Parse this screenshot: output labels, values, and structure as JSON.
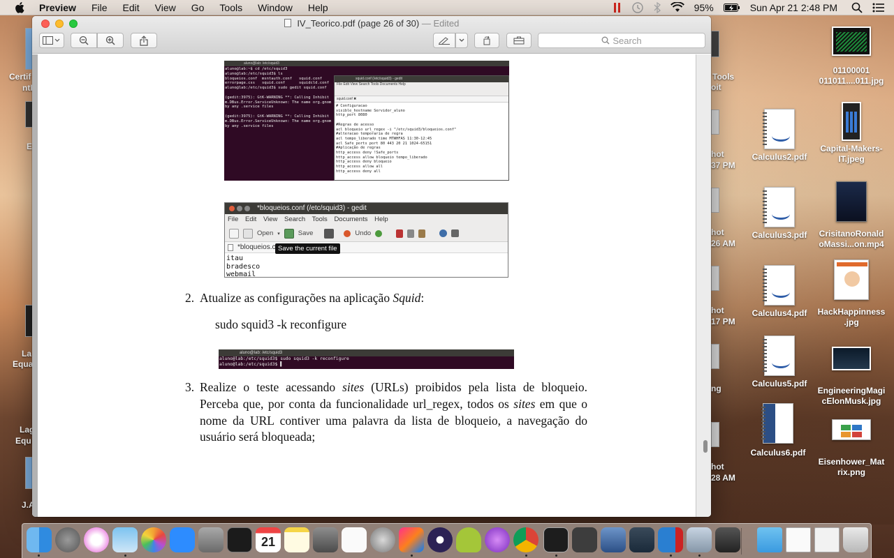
{
  "menubar": {
    "app_name": "Preview",
    "items": [
      "File",
      "Edit",
      "View",
      "Go",
      "Tools",
      "Window",
      "Help"
    ],
    "battery": "95%",
    "datetime": "Sun Apr 21  2:48 PM"
  },
  "window": {
    "title": "IV_Teorico.pdf (page 26 of 30)",
    "edited": "— Edited",
    "search_placeholder": "Search"
  },
  "screenshot1": {
    "terminal_title": "aluno@lab: /etc/squid3",
    "terminal_lines": "aluno@lab:~$ cd /etc/squid3\naluno@lab:/etc/squid3$ ls\nbloqueios.conf  msntauth.conf   squid.conf\nerrorpage.css   squid.conf      squidcld.conf\naluno@lab:/etc/squid3$ sudo gedit squid.conf\n\n(gedit:3975): GtK-WARNING **: Calling Inhibit\nm.DBus.Error.ServiceUnknown: The name org.gnom\nby any .service files\n\n(gedit:3975): GtK-WARNING **: Calling Inhibit\nm.DBus.Error.ServiceUnknown: The name org.gnom\nby any .service files",
    "gedit_title": "squid.conf (/etc/squid3) - gedit",
    "gedit_menu": "File  Edit  View  Search  Tools  Documents  Help",
    "gedit_tab": "squid.conf ✖",
    "gedit_body": "# Configuracao\nvisible_hostname Servidor_aluno\nhttp_port 8080\n\n#Regras de acesso\nacl bloqueio url_regex -i \"/etc/squid3/bloqueios.conf\"\n#alteracao temporaria de regra\nacl tempo_liberado time MTWHFAS 11:30-12:45\nacl Safe_ports port 80 443 20 21 1024-65151\n#Aplicação de regras\nhttp_access deny !Safe_ports\nhttp_access allow bloqueio tempo_liberado\nhttp_access deny bloqueio\nhttp_access allow all\nhttp_access deny all"
  },
  "screenshot2": {
    "title": "*bloqueios.conf (/etc/squid3) - gedit",
    "menu": [
      "File",
      "Edit",
      "View",
      "Search",
      "Tools",
      "Documents",
      "Help"
    ],
    "open_label": "Open",
    "save_label": "Save",
    "undo_label": "Undo",
    "tab_label": "*bloqueios.c",
    "tooltip": "Save the current file",
    "body": "itau\nbradesco\nwebmail"
  },
  "item2": {
    "number": "2.",
    "text_plain": "Atualize as configurações na aplicação ",
    "text_italic": "Squid",
    "text_end": ":"
  },
  "command": "sudo squid3 -k reconfigure",
  "screenshot3": {
    "title": "aluno@lab: /etc/squid3",
    "body": "aluno@lab:/etc/squid3$ sudo squid3 -k reconfigure\naluno@lab:/etc/squid3$ ▌"
  },
  "item3": {
    "number": "3.",
    "p1": "Realize o teste acessando ",
    "i1": "sites",
    "p2": " (URLs) proibidos pela lista de bloqueio. Perceba que, por conta da funcionalidade url_regex, todos os ",
    "i2": "sites",
    "p3": " em que o nome da URL contiver uma palavra da lista de bloqueio, a navegação do usuário será bloqueada;"
  },
  "desktop": {
    "icons": [
      {
        "label": "01100001\n011011....011.jpg"
      },
      {
        "label": "Calculus2.pdf"
      },
      {
        "label": "Capital-Makers-\nIT.jpeg"
      },
      {
        "label": "Calculus3.pdf"
      },
      {
        "label": "CrisitanoRonald\noMassi...on.mp4"
      },
      {
        "label": "Calculus4.pdf"
      },
      {
        "label": "HackHappinness\n.jpg"
      },
      {
        "label": "Calculus5.pdf"
      },
      {
        "label": "EngineeringMagi\ncElonMusk.jpg"
      },
      {
        "label": "Calculus6.pdf"
      },
      {
        "label": "Eisenhower_Mat\nrix.png"
      }
    ],
    "behind_labels": [
      "Tools",
      "oit",
      "hot",
      "37 PM",
      "hot",
      "26 AM",
      "hot",
      "17 PM",
      "ng",
      "hot",
      "28 AM"
    ],
    "left_labels": [
      "Certif",
      "ntP",
      "E",
      "La",
      "Equa",
      "Lag",
      "Equ",
      "J.A"
    ]
  },
  "colors": {
    "accent_red": "#fc5f57",
    "accent_yellow": "#fdbc2e",
    "accent_green": "#28c940",
    "terminal_bg": "#300a24"
  }
}
